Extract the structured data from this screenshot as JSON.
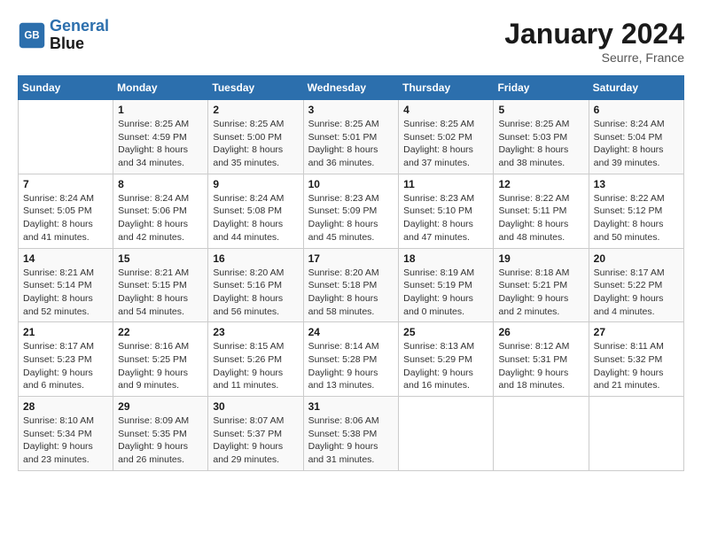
{
  "logo": {
    "line1": "General",
    "line2": "Blue"
  },
  "title": "January 2024",
  "location": "Seurre, France",
  "days_header": [
    "Sunday",
    "Monday",
    "Tuesday",
    "Wednesday",
    "Thursday",
    "Friday",
    "Saturday"
  ],
  "weeks": [
    [
      {
        "day": "",
        "info": ""
      },
      {
        "day": "1",
        "info": "Sunrise: 8:25 AM\nSunset: 4:59 PM\nDaylight: 8 hours\nand 34 minutes."
      },
      {
        "day": "2",
        "info": "Sunrise: 8:25 AM\nSunset: 5:00 PM\nDaylight: 8 hours\nand 35 minutes."
      },
      {
        "day": "3",
        "info": "Sunrise: 8:25 AM\nSunset: 5:01 PM\nDaylight: 8 hours\nand 36 minutes."
      },
      {
        "day": "4",
        "info": "Sunrise: 8:25 AM\nSunset: 5:02 PM\nDaylight: 8 hours\nand 37 minutes."
      },
      {
        "day": "5",
        "info": "Sunrise: 8:25 AM\nSunset: 5:03 PM\nDaylight: 8 hours\nand 38 minutes."
      },
      {
        "day": "6",
        "info": "Sunrise: 8:24 AM\nSunset: 5:04 PM\nDaylight: 8 hours\nand 39 minutes."
      }
    ],
    [
      {
        "day": "7",
        "info": "Sunrise: 8:24 AM\nSunset: 5:05 PM\nDaylight: 8 hours\nand 41 minutes."
      },
      {
        "day": "8",
        "info": "Sunrise: 8:24 AM\nSunset: 5:06 PM\nDaylight: 8 hours\nand 42 minutes."
      },
      {
        "day": "9",
        "info": "Sunrise: 8:24 AM\nSunset: 5:08 PM\nDaylight: 8 hours\nand 44 minutes."
      },
      {
        "day": "10",
        "info": "Sunrise: 8:23 AM\nSunset: 5:09 PM\nDaylight: 8 hours\nand 45 minutes."
      },
      {
        "day": "11",
        "info": "Sunrise: 8:23 AM\nSunset: 5:10 PM\nDaylight: 8 hours\nand 47 minutes."
      },
      {
        "day": "12",
        "info": "Sunrise: 8:22 AM\nSunset: 5:11 PM\nDaylight: 8 hours\nand 48 minutes."
      },
      {
        "day": "13",
        "info": "Sunrise: 8:22 AM\nSunset: 5:12 PM\nDaylight: 8 hours\nand 50 minutes."
      }
    ],
    [
      {
        "day": "14",
        "info": "Sunrise: 8:21 AM\nSunset: 5:14 PM\nDaylight: 8 hours\nand 52 minutes."
      },
      {
        "day": "15",
        "info": "Sunrise: 8:21 AM\nSunset: 5:15 PM\nDaylight: 8 hours\nand 54 minutes."
      },
      {
        "day": "16",
        "info": "Sunrise: 8:20 AM\nSunset: 5:16 PM\nDaylight: 8 hours\nand 56 minutes."
      },
      {
        "day": "17",
        "info": "Sunrise: 8:20 AM\nSunset: 5:18 PM\nDaylight: 8 hours\nand 58 minutes."
      },
      {
        "day": "18",
        "info": "Sunrise: 8:19 AM\nSunset: 5:19 PM\nDaylight: 9 hours\nand 0 minutes."
      },
      {
        "day": "19",
        "info": "Sunrise: 8:18 AM\nSunset: 5:21 PM\nDaylight: 9 hours\nand 2 minutes."
      },
      {
        "day": "20",
        "info": "Sunrise: 8:17 AM\nSunset: 5:22 PM\nDaylight: 9 hours\nand 4 minutes."
      }
    ],
    [
      {
        "day": "21",
        "info": "Sunrise: 8:17 AM\nSunset: 5:23 PM\nDaylight: 9 hours\nand 6 minutes."
      },
      {
        "day": "22",
        "info": "Sunrise: 8:16 AM\nSunset: 5:25 PM\nDaylight: 9 hours\nand 9 minutes."
      },
      {
        "day": "23",
        "info": "Sunrise: 8:15 AM\nSunset: 5:26 PM\nDaylight: 9 hours\nand 11 minutes."
      },
      {
        "day": "24",
        "info": "Sunrise: 8:14 AM\nSunset: 5:28 PM\nDaylight: 9 hours\nand 13 minutes."
      },
      {
        "day": "25",
        "info": "Sunrise: 8:13 AM\nSunset: 5:29 PM\nDaylight: 9 hours\nand 16 minutes."
      },
      {
        "day": "26",
        "info": "Sunrise: 8:12 AM\nSunset: 5:31 PM\nDaylight: 9 hours\nand 18 minutes."
      },
      {
        "day": "27",
        "info": "Sunrise: 8:11 AM\nSunset: 5:32 PM\nDaylight: 9 hours\nand 21 minutes."
      }
    ],
    [
      {
        "day": "28",
        "info": "Sunrise: 8:10 AM\nSunset: 5:34 PM\nDaylight: 9 hours\nand 23 minutes."
      },
      {
        "day": "29",
        "info": "Sunrise: 8:09 AM\nSunset: 5:35 PM\nDaylight: 9 hours\nand 26 minutes."
      },
      {
        "day": "30",
        "info": "Sunrise: 8:07 AM\nSunset: 5:37 PM\nDaylight: 9 hours\nand 29 minutes."
      },
      {
        "day": "31",
        "info": "Sunrise: 8:06 AM\nSunset: 5:38 PM\nDaylight: 9 hours\nand 31 minutes."
      },
      {
        "day": "",
        "info": ""
      },
      {
        "day": "",
        "info": ""
      },
      {
        "day": "",
        "info": ""
      }
    ]
  ]
}
